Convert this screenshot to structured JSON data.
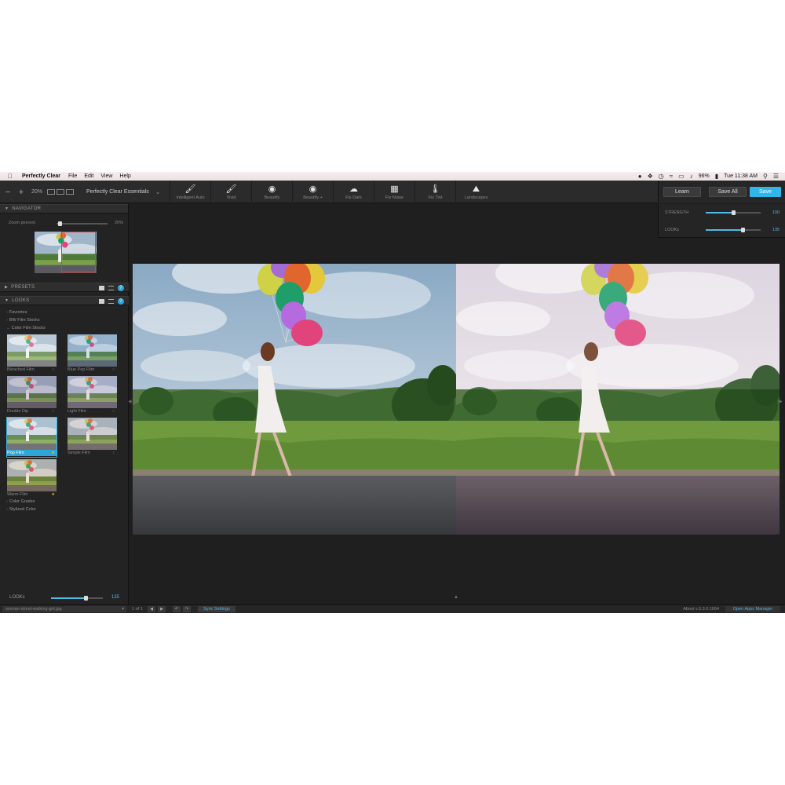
{
  "menubar": {
    "app_name": "Perfectly Clear",
    "items": [
      "File",
      "Edit",
      "View",
      "Help"
    ],
    "battery": "96%",
    "clock": "Tue 11:38 AM"
  },
  "toolbar": {
    "zoom": "20%",
    "preset_selector": "Perfectly Clear Essentials",
    "tools": [
      {
        "label": "Intelligent Auto",
        "icon": "brush-hd-icon"
      },
      {
        "label": "Vivid",
        "icon": "brush-icon"
      },
      {
        "label": "Beautify",
        "icon": "face-icon"
      },
      {
        "label": "Beautify +",
        "icon": "face-plus-icon"
      },
      {
        "label": "Fix Dark",
        "icon": "cloud-icon"
      },
      {
        "label": "Fix Noise",
        "icon": "noise-icon"
      },
      {
        "label": "Fix Tint",
        "icon": "thermometer-icon"
      },
      {
        "label": "Landscapes",
        "icon": "landscape-icon"
      }
    ],
    "learn_label": "Learn",
    "save_all_label": "Save All",
    "save_label": "Save"
  },
  "navigator": {
    "title": "NAVIGATOR",
    "zoom_label": "Zoom percent",
    "zoom_value": "20%",
    "zoom_fraction": 0.05
  },
  "presets": {
    "title": "PRESETS"
  },
  "looks": {
    "title": "LOOKS",
    "groups": [
      "Favorites",
      "BW Film Stocks",
      "Color Film Stocks"
    ],
    "groups_after": [
      "Color Grades",
      "Stylized Color"
    ],
    "thumbnails": [
      {
        "caption": "Bleached Film",
        "favorite": false,
        "selected": false
      },
      {
        "caption": "Blue Pop Film",
        "favorite": false,
        "selected": false
      },
      {
        "caption": "Double Dip",
        "favorite": false,
        "selected": false
      },
      {
        "caption": "Light Film",
        "favorite": false,
        "selected": false
      },
      {
        "caption": "Pop Film",
        "favorite": true,
        "selected": true
      },
      {
        "caption": "Simple Film",
        "favorite": false,
        "selected": false
      },
      {
        "caption": "Warm Film",
        "favorite": true,
        "selected": false
      }
    ],
    "bottom_label": "LOOKs",
    "bottom_value": "135",
    "bottom_fraction": 0.68
  },
  "adjust": {
    "strength_label": "STRENGTH",
    "strength_value": "100",
    "strength_fraction": 0.5,
    "looks_label": "LOOKs",
    "looks_value": "135",
    "looks_fraction": 0.68
  },
  "statusbar": {
    "filename": "woman-street-walking-girl.jpg",
    "pages": "1 of 1",
    "sync_label": "Sync Settings",
    "about": "About v.3.3.0.1064",
    "open_apps_label": "Open Apps Manager"
  },
  "colors": {
    "accent": "#2fb6ea",
    "panel": "#232323",
    "toolbar": "#2b2b2b"
  }
}
